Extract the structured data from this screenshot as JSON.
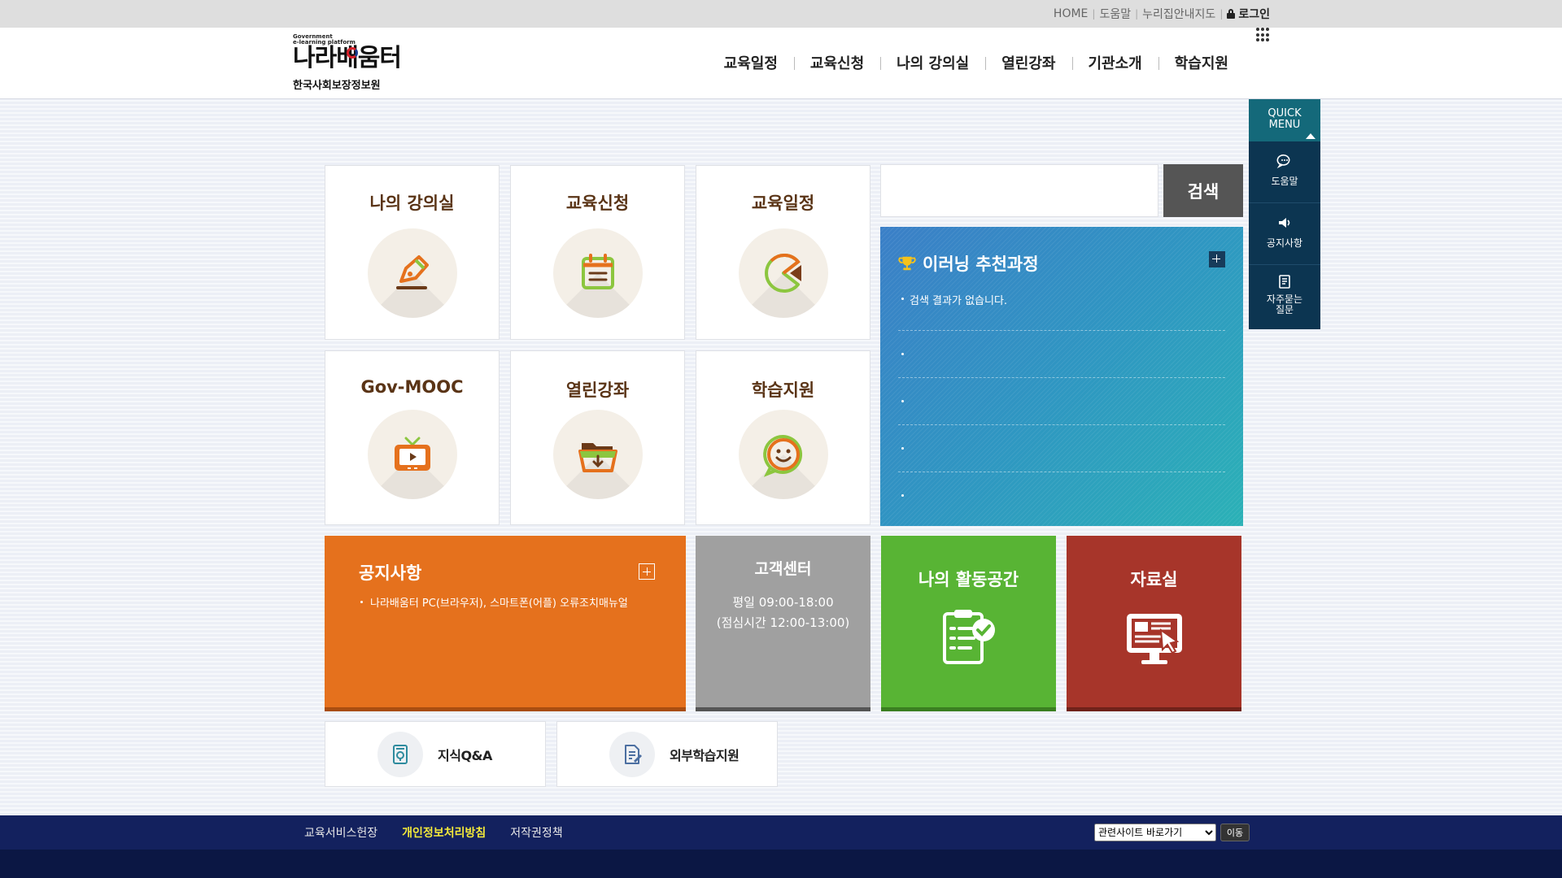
{
  "util": {
    "home": "HOME",
    "help": "도움말",
    "sitemap": "누리집안내지도",
    "login": "로그인"
  },
  "logo": {
    "gov_line1": "Government",
    "gov_line2": "e-learning platform",
    "brand": "나라배움터",
    "org": "한국사회보장정보원"
  },
  "gnb": [
    "교육일정",
    "교육신청",
    "나의 강의실",
    "열린강좌",
    "기관소개",
    "학습지원"
  ],
  "tiles": [
    {
      "title": "나의 강의실",
      "icon": "pen-icon"
    },
    {
      "title": "교육신청",
      "icon": "calendar-icon"
    },
    {
      "title": "교육일정",
      "icon": "pie-chart-icon"
    },
    {
      "title": "Gov-MOOC",
      "icon": "tv-play-icon"
    },
    {
      "title": "열린강좌",
      "icon": "folder-download-icon"
    },
    {
      "title": "학습지원",
      "icon": "smile-icon"
    }
  ],
  "search": {
    "button": "검색",
    "value": ""
  },
  "recommend": {
    "title": "이러닝 추천과정",
    "items": [
      "검색 결과가 없습니다.",
      "",
      "",
      "",
      ""
    ]
  },
  "notice": {
    "title": "공지사항",
    "item": "나라배움터 PC(브라우저), 스마트폰(어플) 오류조치매뉴얼"
  },
  "support": {
    "title": "고객센터",
    "hours": "평일 09:00-18:00",
    "lunch": "(점심시간 12:00-13:00)"
  },
  "activity": {
    "title": "나의 활동공간"
  },
  "archive": {
    "title": "자료실"
  },
  "small_links": [
    {
      "label": "지식Q&A",
      "icon": "qa-book-icon"
    },
    {
      "label": "외부학습지원",
      "icon": "document-edit-icon"
    }
  ],
  "quick": {
    "head": "QUICK\nMENU",
    "head1": "QUICK",
    "head2": "MENU",
    "items": [
      "도움말",
      "공지사항",
      "자주묻는질문"
    ],
    "faq1": "자주묻는",
    "faq2": "질문"
  },
  "footer": {
    "links": [
      "교육서비스헌장",
      "개인정보처리방침",
      "저작권정책"
    ],
    "select": "관련사이트 바로가기",
    "go": "이동"
  },
  "colors": {
    "notice": "#e5711d",
    "support": "#a0a0a0",
    "activity": "#58b434",
    "archive": "#a7352a",
    "recommend": "#2f96c2",
    "footer": "#13215e"
  }
}
